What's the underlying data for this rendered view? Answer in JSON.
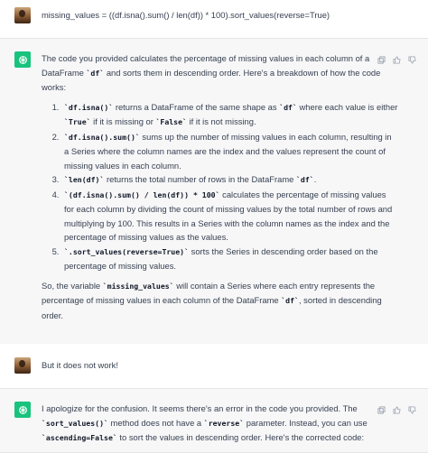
{
  "messages": {
    "user1": {
      "text": "missing_values = ((df.isna().sum() / len(df)) * 100).sort_values(reverse=True)"
    },
    "assistant1": {
      "intro_a": "The code you provided calculates the percentage of missing values in each column of a DataFrame ",
      "intro_code": "`df`",
      "intro_b": " and sorts them in descending order. Here's a breakdown of how the code works:",
      "items": [
        {
          "code": "`df.isna()`",
          "text": " returns a DataFrame of the same shape as ",
          "code2": "`df`",
          "text2": " where each value is either ",
          "code3": "`True`",
          "text3": " if it is missing or ",
          "code4": "`False`",
          "text4": " if it is not missing."
        },
        {
          "code": "`df.isna().sum()`",
          "text": " sums up the number of missing values in each column, resulting in a Series where the column names are the index and the values represent the count of missing values in each column."
        },
        {
          "code": "`len(df)`",
          "text": " returns the total number of rows in the DataFrame ",
          "code2": "`df`",
          "text2": "."
        },
        {
          "code": "`(df.isna().sum() / len(df)) * 100`",
          "text": " calculates the percentage of missing values for each column by dividing the count of missing values by the total number of rows and multiplying by 100. This results in a Series with the column names as the index and the percentage of missing values as the values."
        },
        {
          "code": "`.sort_values(reverse=True)`",
          "text": " sorts the Series in descending order based on the percentage of missing values."
        }
      ],
      "outro_a": "So, the variable ",
      "outro_code": "`missing_values`",
      "outro_b": " will contain a Series where each entry represents the percentage of missing values in each column of the DataFrame ",
      "outro_code2": "`df`",
      "outro_c": ", sorted in descending order."
    },
    "user2": {
      "text": "But it does not work!"
    },
    "assistant2": {
      "a": "I apologize for the confusion. It seems there's an error in the code you provided. The ",
      "code1": "`sort_values()`",
      "b": " method does not have a ",
      "code2": "`reverse`",
      "c": " parameter. Instead, you can use ",
      "code3": "`ascending=False`",
      "d": " to sort the values in descending order. Here's the corrected code:"
    }
  },
  "icons": {
    "copy": "copy-icon",
    "thumbs_up": "thumbs-up-icon",
    "thumbs_down": "thumbs-down-icon",
    "gpt": "openai-logo-icon"
  },
  "colors": {
    "gpt_green": "#19c37d",
    "assistant_bg": "#f7f7f8",
    "text": "#374151"
  }
}
